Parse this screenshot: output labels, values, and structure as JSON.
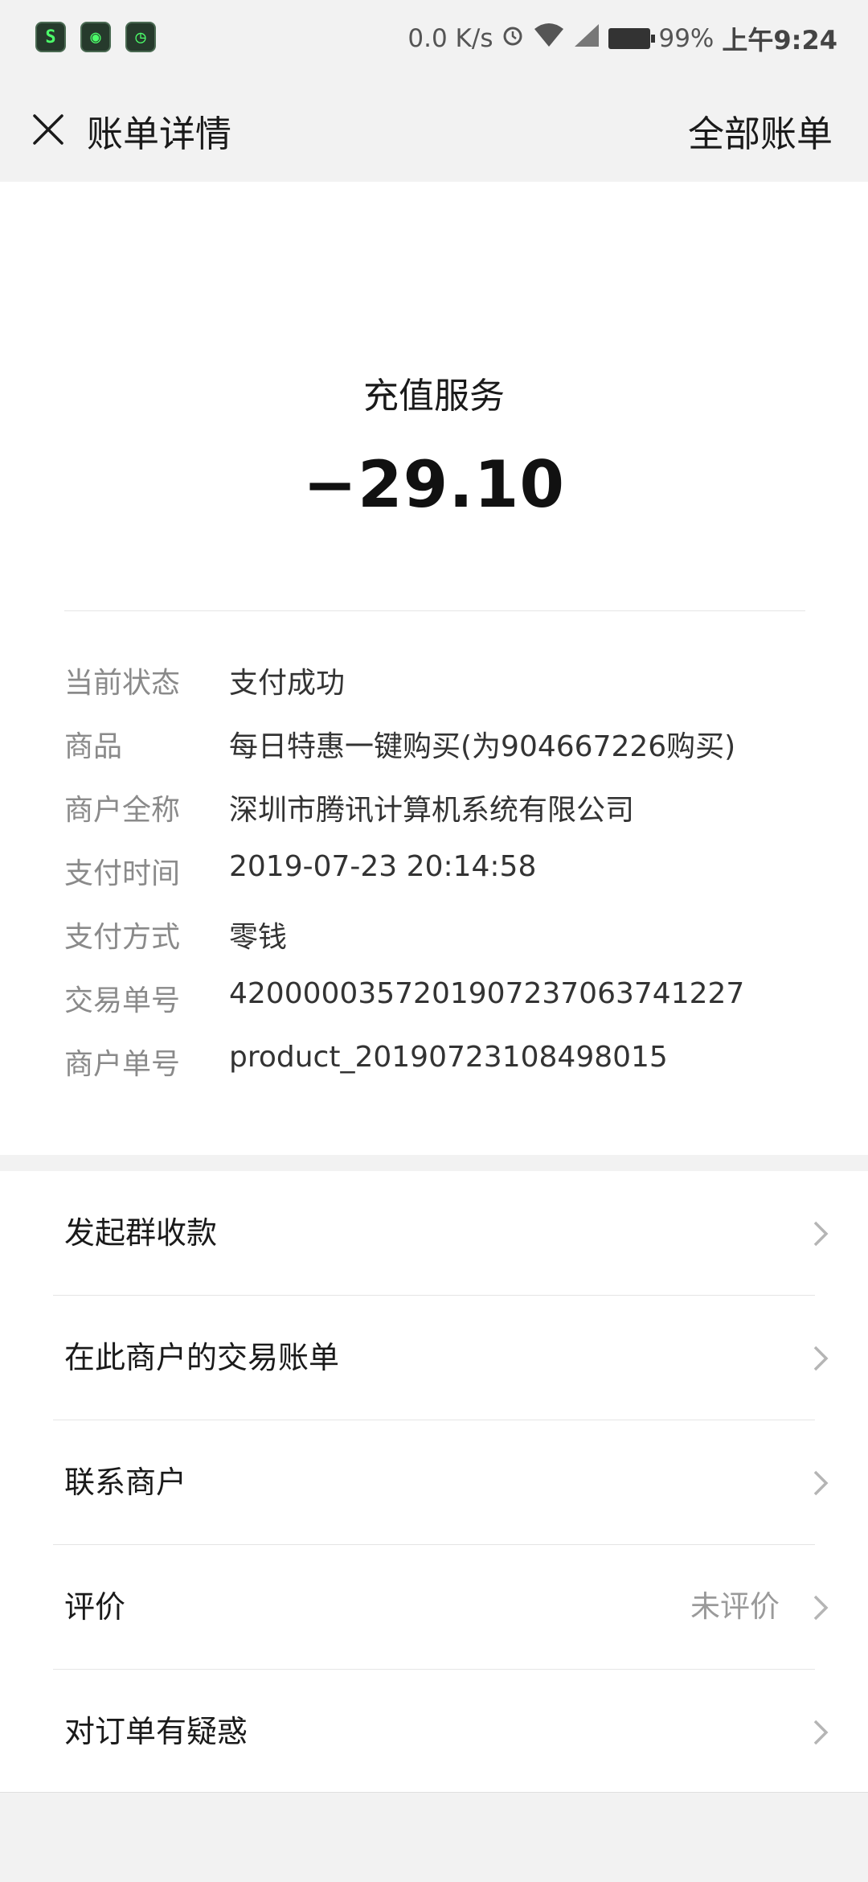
{
  "status_bar": {
    "net_speed": "0.0 K/s",
    "battery": "99%",
    "time": "上午9:24"
  },
  "nav": {
    "title": "账单详情",
    "right_label": "全部账单"
  },
  "summary": {
    "merchant_title": "充值服务",
    "amount": "−29.10"
  },
  "details": [
    {
      "label": "当前状态",
      "value": "支付成功"
    },
    {
      "label": "商品",
      "value": "每日特惠一键购买(为904667226购买)"
    },
    {
      "label": "商户全称",
      "value": "深圳市腾讯计算机系统有限公司"
    },
    {
      "label": "支付时间",
      "value": "2019-07-23 20:14:58"
    },
    {
      "label": "支付方式",
      "value": "零钱"
    },
    {
      "label": "交易单号",
      "value": "4200000357201907237063741227"
    },
    {
      "label": "商户单号",
      "value": "product_20190723108498015"
    }
  ],
  "menu": [
    {
      "label": "发起群收款",
      "sub": ""
    },
    {
      "label": "在此商户的交易账单",
      "sub": ""
    },
    {
      "label": "联系商户",
      "sub": ""
    },
    {
      "label": "评价",
      "sub": "未评价"
    },
    {
      "label": "对订单有疑惑",
      "sub": ""
    }
  ]
}
